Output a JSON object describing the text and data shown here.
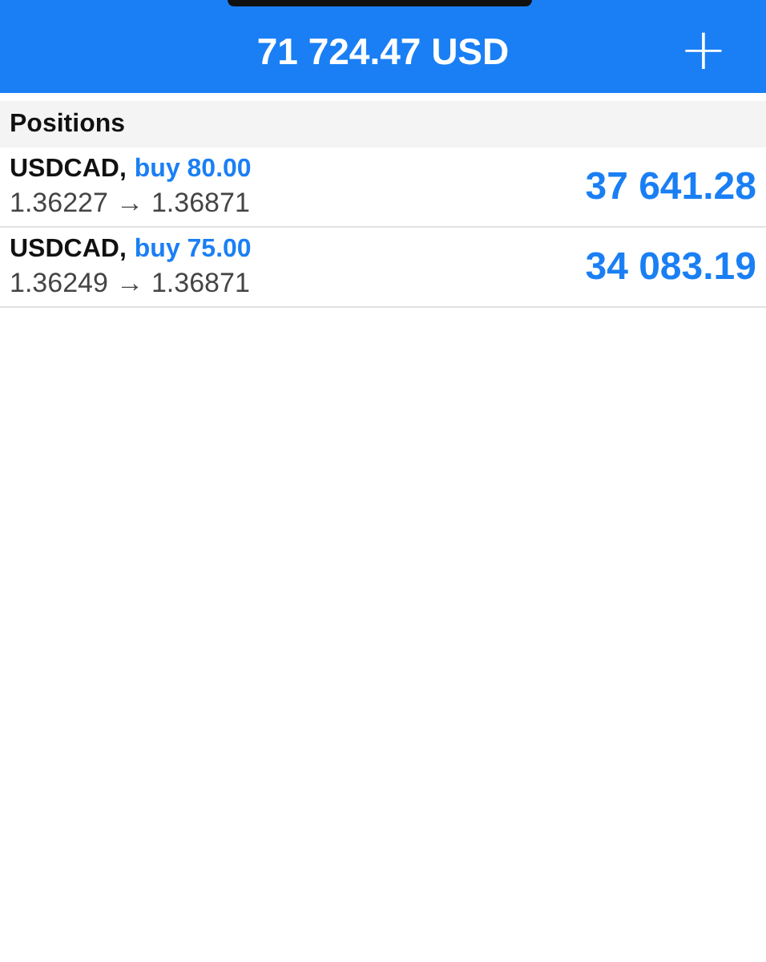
{
  "header": {
    "balance": "71 724.47 USD",
    "add_button": "+"
  },
  "section": {
    "title": "Positions"
  },
  "positions": [
    {
      "symbol": "USDCAD,",
      "order": "buy 80.00",
      "open_price": "1.36227",
      "arrow": "→",
      "current_price": "1.36871",
      "profit": "37 641.28"
    },
    {
      "symbol": "USDCAD,",
      "order": "buy 75.00",
      "open_price": "1.36249",
      "arrow": "→",
      "current_price": "1.36871",
      "profit": "34 083.19"
    }
  ]
}
